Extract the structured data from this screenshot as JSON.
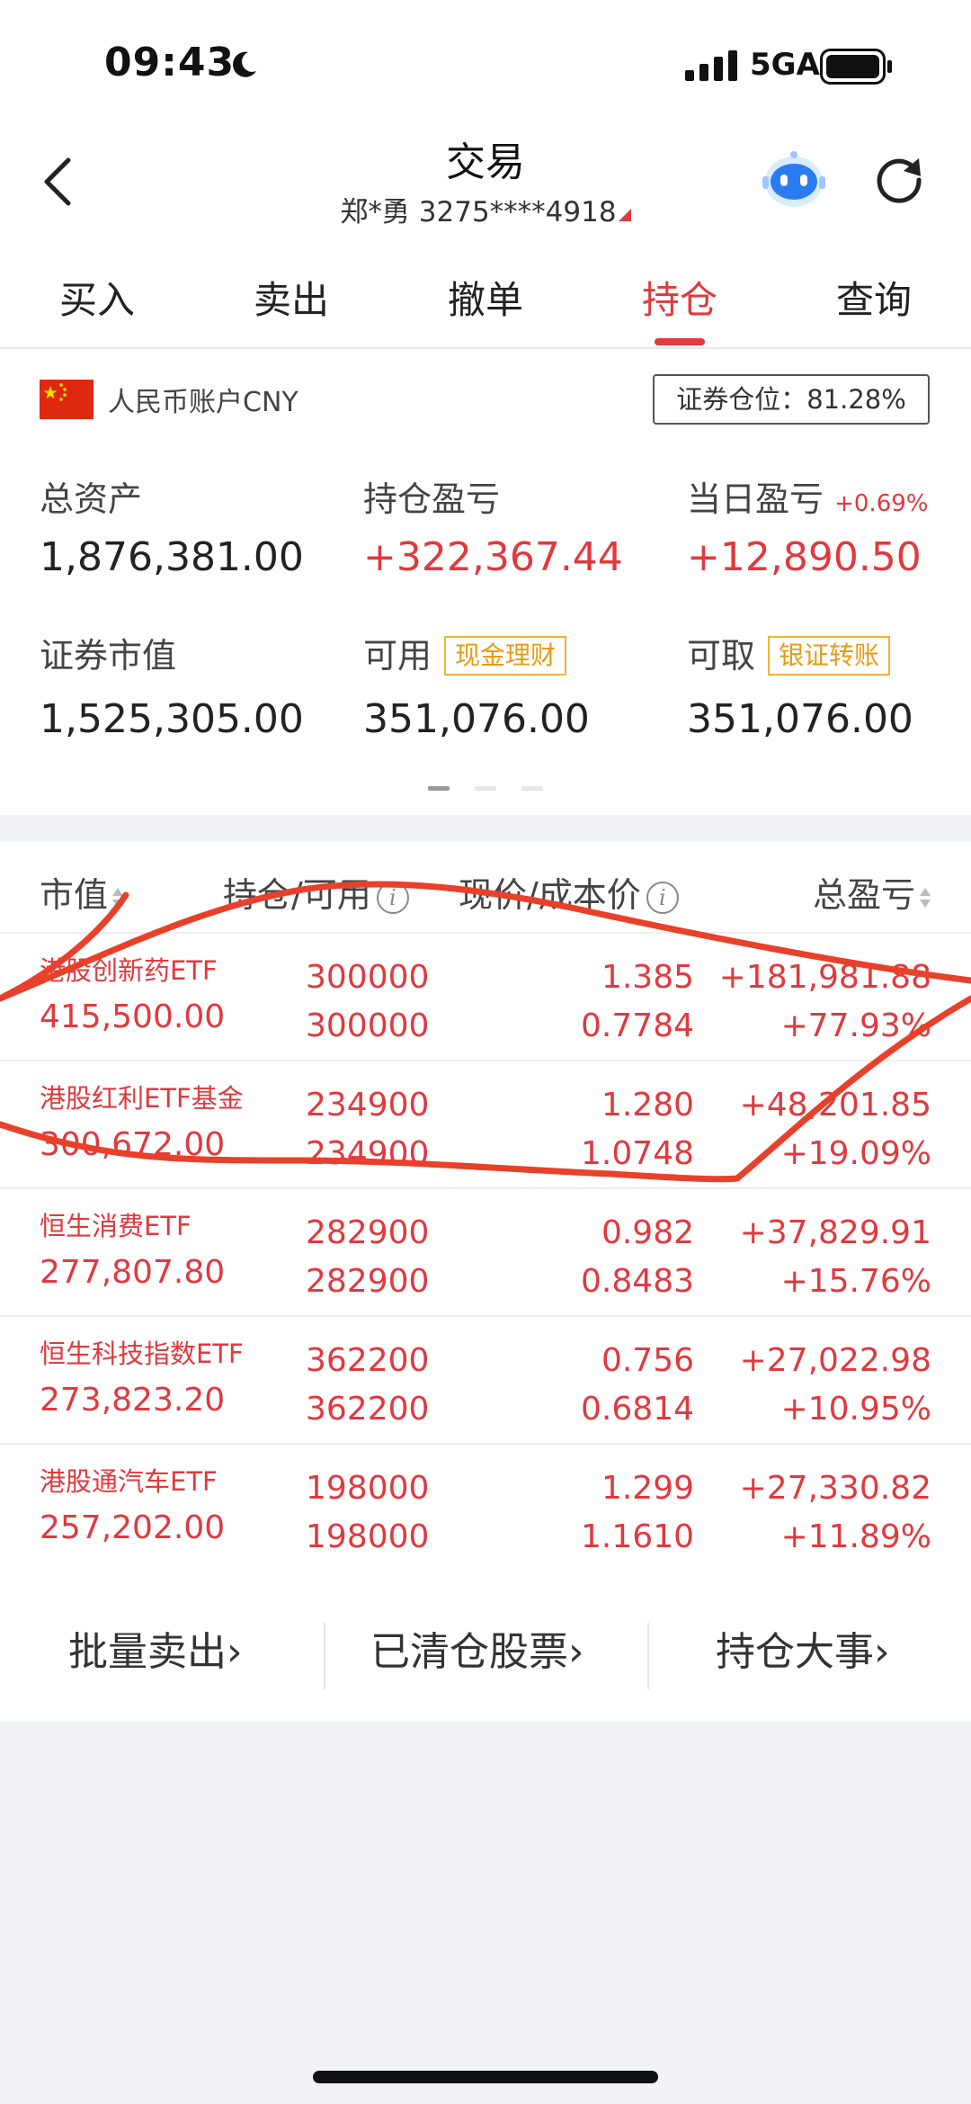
{
  "status_bar": {
    "time": "09:43",
    "network": "5GA"
  },
  "header": {
    "title": "交易",
    "account": "郑*勇 3275****4918"
  },
  "tabs": [
    {
      "label": "买入"
    },
    {
      "label": "卖出"
    },
    {
      "label": "撤单"
    },
    {
      "label": "持仓",
      "active": true
    },
    {
      "label": "查询"
    }
  ],
  "summary": {
    "account_name": "人民币账户CNY",
    "position_ratio": "证券仓位：81.28%",
    "total_assets_label": "总资产",
    "total_assets": "1,876,381.00",
    "position_pl_label": "持仓盈亏",
    "position_pl": "+322,367.44",
    "daily_pl_label": "当日盈亏",
    "daily_pl_pct": "+0.69%",
    "daily_pl": "+12,890.50",
    "securities_value_label": "证券市值",
    "securities_value": "1,525,305.00",
    "available_label": "可用",
    "available_tag": "现金理财",
    "available": "351,076.00",
    "withdrawable_label": "可取",
    "withdrawable_tag": "银证转账",
    "withdrawable": "351,076.00"
  },
  "table": {
    "headers": {
      "market_value": "市值",
      "position": "持仓/可用",
      "price": "现价/成本价",
      "pl": "总盈亏"
    },
    "rows": [
      {
        "name": "港股创新药ETF",
        "market_value": "415,500.00",
        "position": "300000",
        "available": "300000",
        "price": "1.385",
        "cost": "0.7784",
        "pl": "+181,981.88",
        "pl_pct": "+77.93%"
      },
      {
        "name": "港股红利ETF基金",
        "market_value": "300,672.00",
        "position": "234900",
        "available": "234900",
        "price": "1.280",
        "cost": "1.0748",
        "pl": "+48,201.85",
        "pl_pct": "+19.09%"
      },
      {
        "name": "恒生消费ETF",
        "market_value": "277,807.80",
        "position": "282900",
        "available": "282900",
        "price": "0.982",
        "cost": "0.8483",
        "pl": "+37,829.91",
        "pl_pct": "+15.76%"
      },
      {
        "name": "恒生科技指数ETF",
        "market_value": "273,823.20",
        "position": "362200",
        "available": "362200",
        "price": "0.756",
        "cost": "0.6814",
        "pl": "+27,022.98",
        "pl_pct": "+10.95%"
      },
      {
        "name": "港股通汽车ETF",
        "market_value": "257,202.00",
        "position": "198000",
        "available": "198000",
        "price": "1.299",
        "cost": "1.1610",
        "pl": "+27,330.82",
        "pl_pct": "+11.89%"
      }
    ]
  },
  "footer_links": [
    {
      "label": "批量卖出"
    },
    {
      "label": "已清仓股票"
    },
    {
      "label": "持仓大事"
    }
  ],
  "colors": {
    "accent_red": "#e0393e",
    "tag_orange": "#f0b23a"
  }
}
